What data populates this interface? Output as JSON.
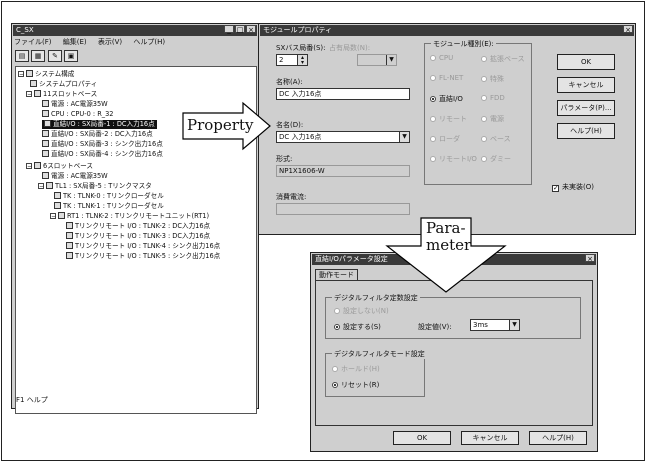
{
  "tree_window": {
    "title": "C_SX",
    "min": "_",
    "max": "□",
    "close": "×",
    "menu": [
      "ファイル(F)",
      "編集(E)",
      "表示(V)",
      "ヘルプ(H)"
    ],
    "tree": [
      {
        "text": "システム構成"
      },
      {
        "text": "システムプロパティ"
      },
      {
        "text": "11スロットベース"
      },
      {
        "text": "電源 : AC電源35W"
      },
      {
        "text": "CPU : CPU-0 : R_32"
      },
      {
        "text": "直結I/O : SX局番-1 : DC入力16点"
      },
      {
        "text": "直結I/O : SX局番-2 : DC入力16点"
      },
      {
        "text": "直結I/O : SX局番-3 : シンク出力16点"
      },
      {
        "text": "直結I/O : SX局番-4 : シンク出力16点"
      },
      {
        "text": "6スロットベース"
      },
      {
        "text": "電源 : AC電源35W"
      },
      {
        "text": "TL1 : SX局番-5 : Tリンクマスタ"
      },
      {
        "text": "TK : TLNK-0 : Tリンクローダセル"
      },
      {
        "text": "TK : TLNK-1 : Tリンクローダセル"
      },
      {
        "text": "RT1 : TLNK-2 : Tリンクリモートユニット(RT1)"
      },
      {
        "text": "Tリンクリモート I/O : TLNK-2 : DC入力16点"
      },
      {
        "text": "Tリンクリモート I/O : TLNK-3 : DC入力16点"
      },
      {
        "text": "Tリンクリモート I/O : TLNK-4 : シンク出力16点"
      },
      {
        "text": "Tリンクリモート I/O : TLNK-5 : シンク出力16点"
      }
    ],
    "status": "F1 ヘルプ"
  },
  "property_dialog": {
    "title": "モジュールプロパティ",
    "close": "×",
    "sx_station_label": "SXバス局番(S):",
    "sx_station_value": "2",
    "occupied_label": "占有局数(N):",
    "name_label": "名称(A):",
    "name_value": "DC 入力16点",
    "alias_label": "名名(D):",
    "alias_value": "DC 入力16点",
    "model_label": "形式:",
    "model_value": "NP1X1606-W",
    "power_label": "消費電流:",
    "module_type_group": "モジュール種別(E):",
    "module_types": [
      {
        "label": "CPU",
        "on": false,
        "dim": true
      },
      {
        "label": "拡張ベース",
        "on": false,
        "dim": true
      },
      {
        "label": "FL-NET",
        "on": false,
        "dim": true
      },
      {
        "label": "特殊",
        "on": false,
        "dim": true
      },
      {
        "label": "直結I/O",
        "on": true,
        "dim": false
      },
      {
        "label": "FDD",
        "on": false,
        "dim": true
      },
      {
        "label": "リモート",
        "on": false,
        "dim": true
      },
      {
        "label": "電源",
        "on": false,
        "dim": true
      },
      {
        "label": "ローダ",
        "on": false,
        "dim": true
      },
      {
        "label": "ベース",
        "on": false,
        "dim": true
      },
      {
        "label": "リモートI/O",
        "on": false,
        "dim": true
      },
      {
        "label": "ダミー",
        "on": false,
        "dim": true
      }
    ],
    "not_mounted_label": "未実装(O)",
    "not_mounted_checked": true,
    "ok": "OK",
    "cancel": "キャンセル",
    "parameter": "パラメータ(P)...",
    "help": "ヘルプ(H)"
  },
  "parameter_dialog": {
    "title": "直結I/Oパラメータ設定",
    "close": "×",
    "tab": "動作モード",
    "filter_group": "デジタルフィルタ定数設定",
    "radio_no": "設定しない(N)",
    "radio_yes": "設定する(S)",
    "setting_label": "設定値(V):",
    "setting_value": "3ms",
    "hold_group": "デジタルフィルタモード設定",
    "radio_hold": "ホールド(H)",
    "radio_reset": "リセット(R)",
    "ok": "OK",
    "cancel": "キャンセル",
    "help": "ヘルプ(H)"
  },
  "callouts": {
    "property": "Property",
    "parameter_line1": "Para-",
    "parameter_line2": "meter"
  }
}
